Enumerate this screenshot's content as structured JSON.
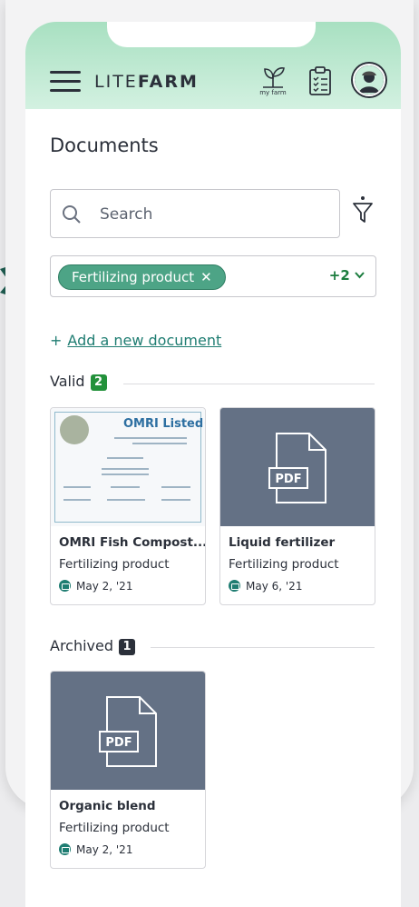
{
  "header": {
    "brand_light": "LITE",
    "brand_bold": "FARM",
    "farm_caption": "my farm"
  },
  "page": {
    "title": "Documents"
  },
  "search": {
    "placeholder": "Search",
    "value": ""
  },
  "filters": {
    "active_chip": "Fertilizing product",
    "chip_remove": "✕",
    "more_count": "+2"
  },
  "actions": {
    "add_plus": "+",
    "add_document": "Add a new document"
  },
  "sections": {
    "valid": {
      "label": "Valid",
      "count": "2"
    },
    "archived": {
      "label": "Archived",
      "count": "1"
    }
  },
  "documents": {
    "valid": [
      {
        "name": "OMRI Fish Compost...",
        "type": "Fertilizing product",
        "date": "May 2, '21",
        "thumbnail": "certificate",
        "thumb_title": "OMRI Listed®"
      },
      {
        "name": "Liquid fertilizer",
        "type": "Fertilizing product",
        "date": "May 6, '21",
        "thumbnail": "pdf",
        "thumb_label": "PDF"
      }
    ],
    "archived": [
      {
        "name": "Organic blend",
        "type": "Fertilizing product",
        "date": "May 2, '21",
        "thumbnail": "pdf",
        "thumb_label": "PDF"
      }
    ]
  },
  "colors": {
    "header_gradient": "#a8e0c1",
    "chip": "#4da486",
    "link": "#1f7d72",
    "valid_badge": "#23913b",
    "archived_badge": "#2b303a",
    "pdf_thumb": "#647185"
  }
}
